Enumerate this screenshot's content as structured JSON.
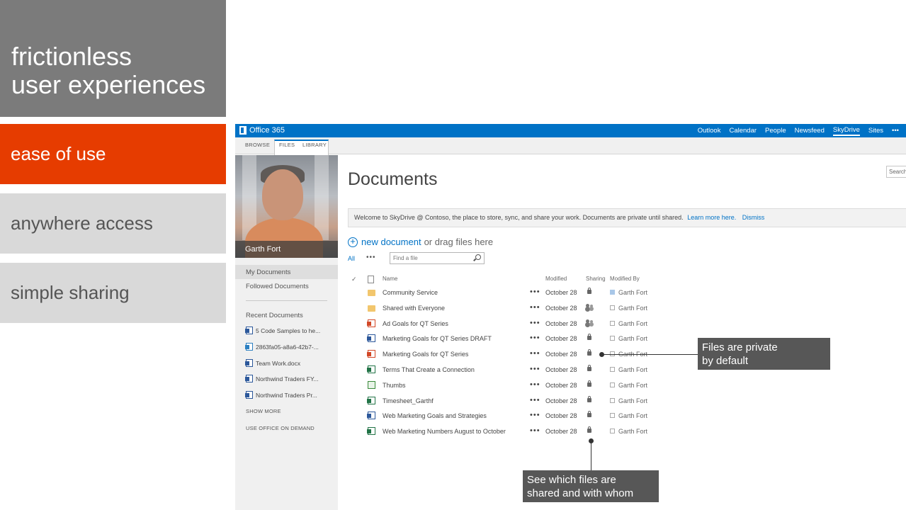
{
  "slide": {
    "title_line1": "frictionless",
    "title_line2": "user experiences",
    "topics": [
      "ease of use",
      "anywhere access",
      "simple sharing"
    ]
  },
  "suitebar": {
    "brand": "Office 365",
    "nav": [
      "Outlook",
      "Calendar",
      "People",
      "Newsfeed",
      "SkyDrive",
      "Sites",
      "•••"
    ]
  },
  "ribbon": {
    "tabs": [
      "BROWSE",
      "FILES",
      "LIBRARY"
    ]
  },
  "profile": {
    "name": "Garth Fort"
  },
  "leftnav": {
    "my_documents": "My Documents",
    "followed_documents": "Followed Documents",
    "recent_heading": "Recent Documents",
    "recent": [
      "5 Code Samples to he...",
      "2863fa05-a8a6-42b7-...",
      "Team Work.docx",
      "Northwind Traders FY...",
      "Northwind Traders Pr..."
    ],
    "show_more": "SHOW MORE",
    "use_office": "USE OFFICE ON DEMAND"
  },
  "main": {
    "search_placeholder": "Search",
    "title": "Documents",
    "welcome_text": "Welcome to SkyDrive @ Contoso, the place to store, sync, and share your work. Documents are private until shared.",
    "learn_more": "Learn more here.",
    "dismiss": "Dismiss",
    "new_document": "new document",
    "drag_text": "or drag files here",
    "view_all": "All",
    "view_more": "•••",
    "find_placeholder": "Find a file",
    "columns": {
      "check": "✓",
      "name": "Name",
      "modified": "Modified",
      "sharing": "Sharing",
      "modified_by": "Modified By"
    }
  },
  "files": [
    {
      "name": "Community Service",
      "type": "folder",
      "modified": "October 28",
      "sharing": "lock",
      "by": "Garth Fort"
    },
    {
      "name": "Shared with Everyone",
      "type": "folder",
      "modified": "October 28",
      "sharing": "people",
      "by": "Garth Fort"
    },
    {
      "name": "Ad Goals for QT Series",
      "type": "pptx",
      "modified": "October 28",
      "sharing": "people",
      "by": "Garth Fort"
    },
    {
      "name": "Marketing Goals for QT Series DRAFT",
      "type": "docx",
      "modified": "October 28",
      "sharing": "lock",
      "by": "Garth Fort"
    },
    {
      "name": "Marketing Goals for QT Series",
      "type": "pptx",
      "modified": "October 28",
      "sharing": "lock",
      "by": "Garth Fort"
    },
    {
      "name": "Terms That Create a Connection",
      "type": "xlsx",
      "modified": "October 28",
      "sharing": "lock",
      "by": "Garth Fort"
    },
    {
      "name": "Thumbs",
      "type": "image",
      "modified": "October 28",
      "sharing": "lock",
      "by": "Garth Fort"
    },
    {
      "name": "Timesheet_Garthf",
      "type": "xlsx",
      "modified": "October 28",
      "sharing": "lock",
      "by": "Garth Fort"
    },
    {
      "name": "Web Marketing Goals and Strategies",
      "type": "docx",
      "modified": "October 28",
      "sharing": "lock",
      "by": "Garth Fort"
    },
    {
      "name": "Web Marketing Numbers August to October",
      "type": "xlsx",
      "modified": "October 28",
      "sharing": "lock",
      "by": "Garth Fort"
    }
  ],
  "callouts": {
    "private_line1": "Files are private",
    "private_line2": "by default",
    "shared_line1": "See which files are",
    "shared_line2": "shared and with whom"
  },
  "colors": {
    "accent": "#e63c00",
    "suitebar": "#0072c6",
    "callout": "#575757",
    "topic_inactive": "#d9d9d9"
  }
}
